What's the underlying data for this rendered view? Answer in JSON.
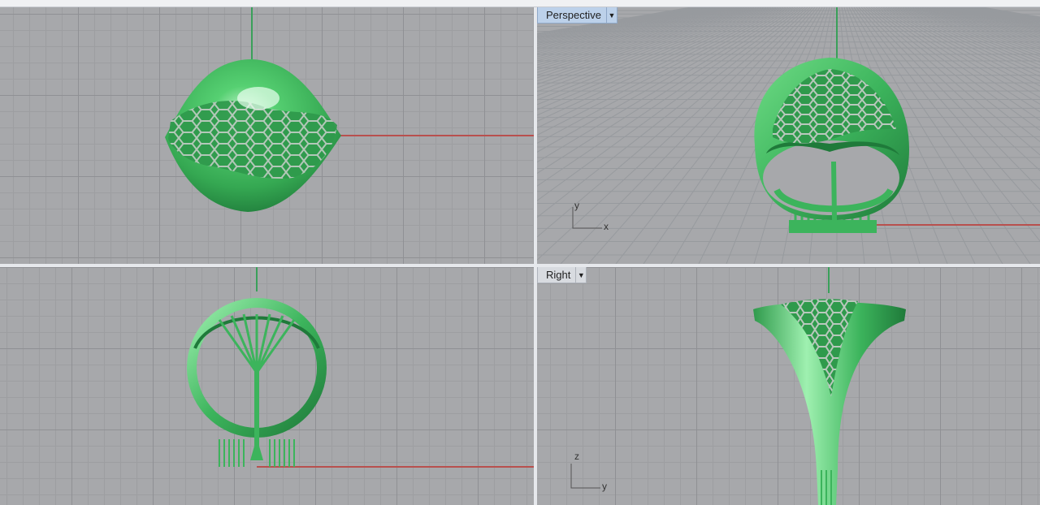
{
  "viewports": {
    "top": {
      "label": ""
    },
    "perspective": {
      "label": "Perspective",
      "dropdown_icon": "chevron-down-icon"
    },
    "front": {
      "label": ""
    },
    "right": {
      "label": "Right",
      "dropdown_icon": "chevron-down-icon"
    }
  },
  "axes": {
    "perspective": {
      "x": "x",
      "y": "y"
    },
    "right": {
      "horizontal": "y",
      "vertical": "z"
    }
  },
  "colors": {
    "model": "#3cb45c",
    "model_highlight": "#9ff0b0",
    "model_shadow": "#1f7a3a",
    "x_axis": "#b8504e",
    "y_axis": "#3aa05a",
    "grid_bg": "#a7a8ab",
    "active_label": "#bcd1ea"
  }
}
